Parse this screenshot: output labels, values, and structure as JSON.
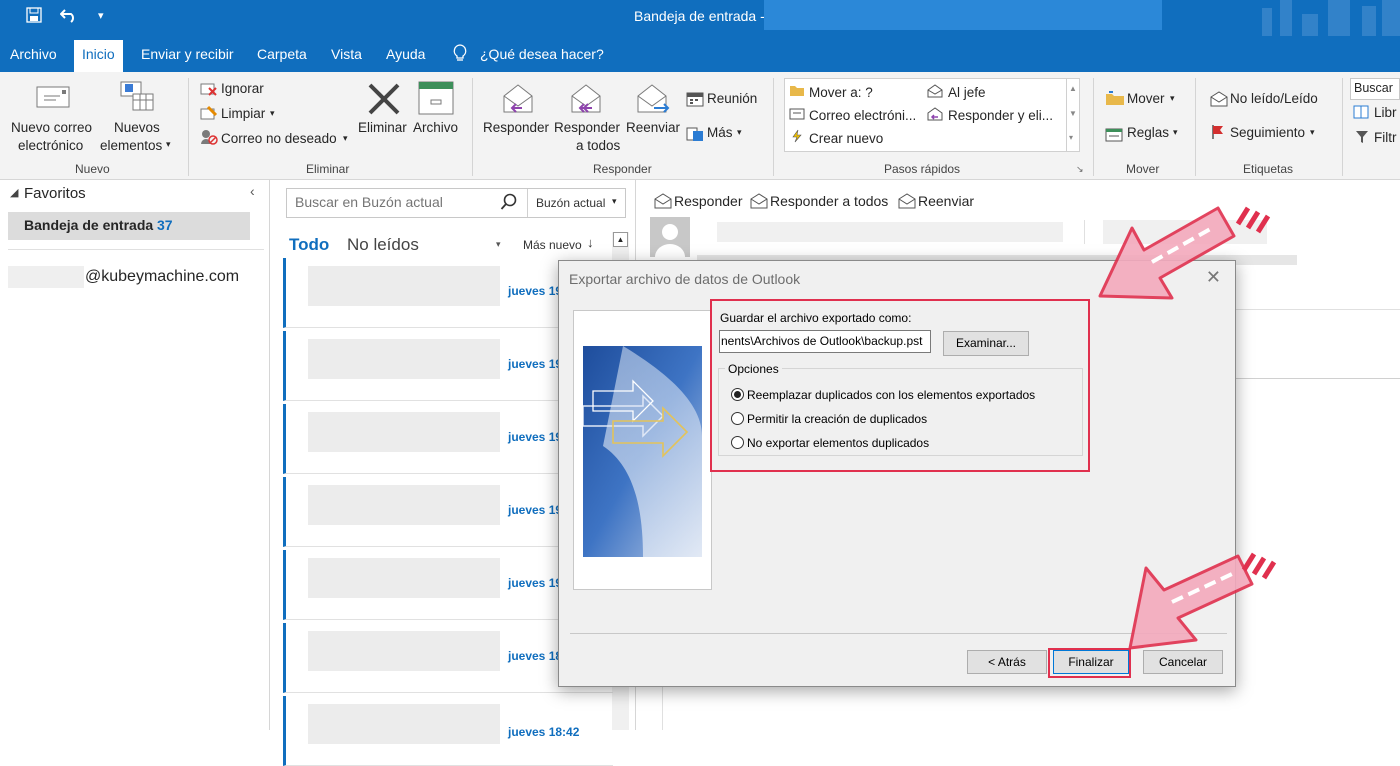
{
  "window": {
    "title": "Bandeja de entrada -"
  },
  "menu": {
    "tabs": [
      "Archivo",
      "Inicio",
      "Enviar y recibir",
      "Carpeta",
      "Vista",
      "Ayuda"
    ],
    "tell_me": "¿Qué desea hacer?"
  },
  "ribbon": {
    "nuevo": {
      "new_email": [
        "Nuevo correo",
        "electrónico"
      ],
      "new_items": [
        "Nuevos",
        "elementos"
      ],
      "group": "Nuevo"
    },
    "eliminar": {
      "ignore": "Ignorar",
      "clean": "Limpiar",
      "junk": "Correo no deseado",
      "delete": "Eliminar",
      "archive": "Archivo",
      "group": "Eliminar"
    },
    "responder": {
      "reply": "Responder",
      "reply_all": [
        "Responder",
        "a todos"
      ],
      "forward": "Reenviar",
      "meeting": "Reunión",
      "more": "Más",
      "group": "Responder"
    },
    "pasos": {
      "move_to": "Mover a: ?",
      "to_boss": "Al jefe",
      "email": "Correo electróni...",
      "reply_delete": "Responder y eli...",
      "create_new": "Crear nuevo",
      "group": "Pasos rápidos"
    },
    "mover": {
      "move": "Mover",
      "rules": "Reglas",
      "group": "Mover"
    },
    "etiquetas": {
      "unread": "No leído/Leído",
      "followup": "Seguimiento",
      "group": "Etiquetas"
    },
    "buscar": {
      "search": "Buscar",
      "libr": "Libr",
      "filt": "Filtr"
    }
  },
  "folders": {
    "favorites": "Favoritos",
    "inbox": "Bandeja de entrada",
    "inbox_count": "37",
    "account": "@kubeymachine.com"
  },
  "list": {
    "search_placeholder": "Buscar en Buzón actual",
    "scope": "Buzón actual",
    "filter_all": "Todo",
    "filter_unread": "No leídos",
    "sort": "Más nuevo",
    "dates": [
      "jueves 19",
      "jueves 19",
      "jueves 19",
      "jueves 19",
      "jueves 19",
      "jueves 18",
      "jueves 18:42"
    ]
  },
  "reading": {
    "reply": "Responder",
    "reply_all": "Responder a todos",
    "forward": "Reenviar"
  },
  "dialog": {
    "title": "Exportar archivo de datos de Outlook",
    "save_as_label": "Guardar el archivo exportado como:",
    "path_value": "nents\\Archivos de Outlook\\backup.pst",
    "browse": "Examinar...",
    "options_legend": "Opciones",
    "options": [
      "Reemplazar duplicados con los elementos exportados",
      "Permitir la creación de duplicados",
      "No exportar elementos duplicados"
    ],
    "selected_option": 0,
    "back": "< Atrás",
    "finish": "Finalizar",
    "cancel": "Cancelar"
  },
  "colors": {
    "brand": "#106ebe",
    "highlight": "#e0304e",
    "arrow": "#f2a0b4"
  }
}
